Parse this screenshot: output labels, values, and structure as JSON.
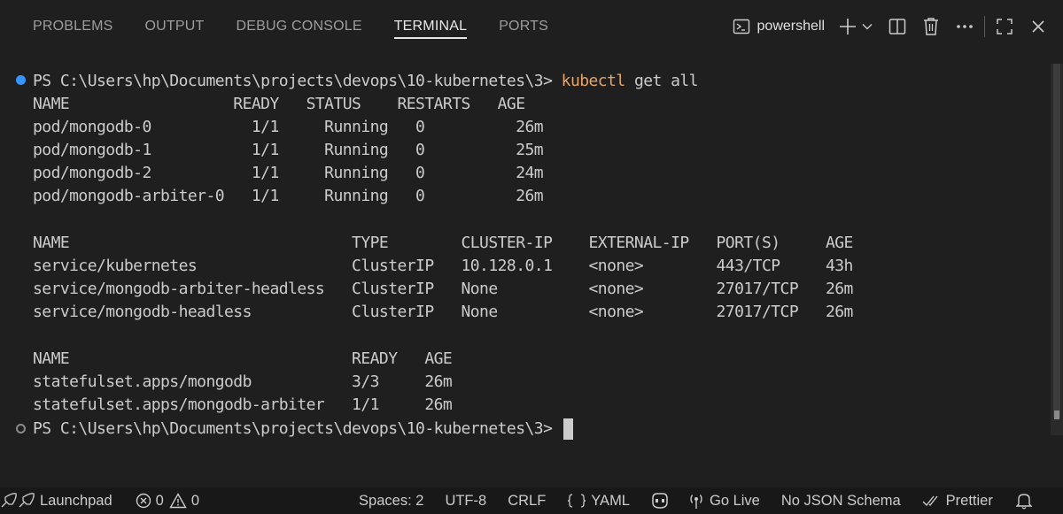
{
  "tabs": [
    "PROBLEMS",
    "OUTPUT",
    "DEBUG CONSOLE",
    "TERMINAL",
    "PORTS"
  ],
  "active_tab": "TERMINAL",
  "toolbar": {
    "shell_label": "powershell",
    "icons": [
      "terminal-icon",
      "add-icon",
      "chevron-down-icon",
      "split-icon",
      "trash-icon",
      "more-icon",
      "maximize-icon",
      "close-icon"
    ]
  },
  "terminal": {
    "prompt1": "PS C:\\Users\\hp\\Documents\\projects\\devops\\10-kubernetes\\3> ",
    "command_name": "kubectl",
    "command_args": " get all",
    "pods_header": "NAME                  READY   STATUS    RESTARTS   AGE",
    "pods": [
      "pod/mongodb-0           1/1     Running   0          26m",
      "pod/mongodb-1           1/1     Running   0          25m",
      "pod/mongodb-2           1/1     Running   0          24m",
      "pod/mongodb-arbiter-0   1/1     Running   0          26m"
    ],
    "services_header": "NAME                               TYPE        CLUSTER-IP    EXTERNAL-IP   PORT(S)     AGE",
    "services": [
      "service/kubernetes                 ClusterIP   10.128.0.1    <none>        443/TCP     43h",
      "service/mongodb-arbiter-headless   ClusterIP   None          <none>        27017/TCP   26m",
      "service/mongodb-headless           ClusterIP   None          <none>        27017/TCP   26m"
    ],
    "sets_header": "NAME                               READY   AGE",
    "sets": [
      "statefulset.apps/mongodb           3/3     26m",
      "statefulset.apps/mongodb-arbiter   1/1     26m"
    ],
    "prompt2": "PS C:\\Users\\hp\\Documents\\projects\\devops\\10-kubernetes\\3> "
  },
  "statusbar": {
    "launchpad": "Launchpad",
    "errors": "0",
    "warnings": "0",
    "spaces": "Spaces: 2",
    "encoding": "UTF-8",
    "eol": "CRLF",
    "language": "YAML",
    "golive": "Go Live",
    "schema": "No JSON Schema",
    "prettier": "Prettier"
  },
  "colors": {
    "background": "#1f1f1f",
    "command": "#e5a56c",
    "success_dot": "#3794ff",
    "text": "#cccccc"
  }
}
